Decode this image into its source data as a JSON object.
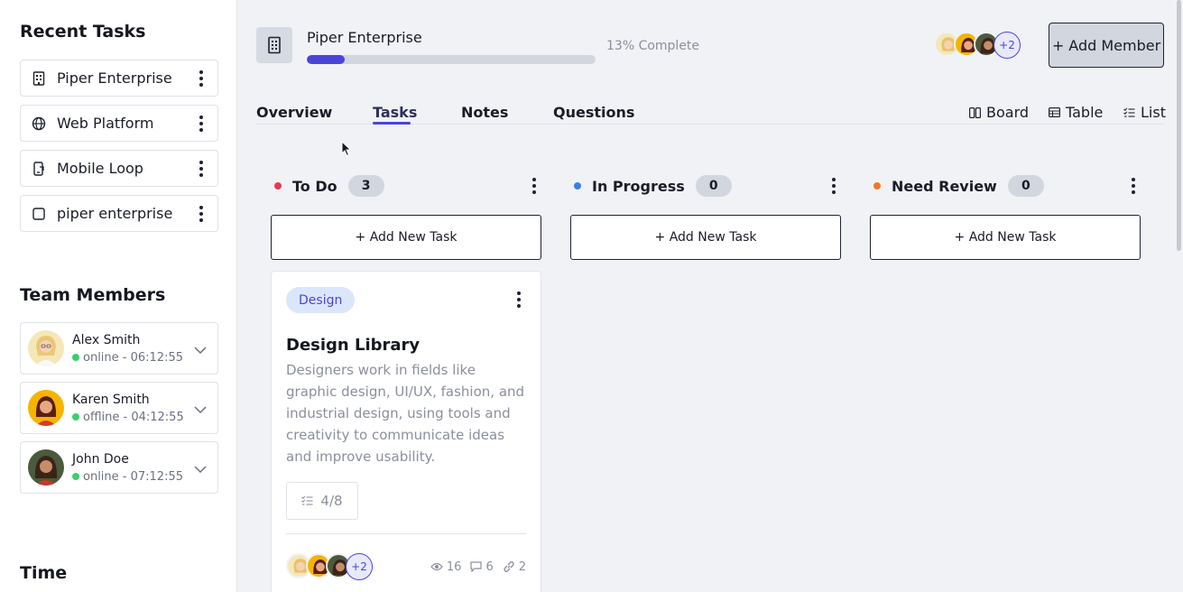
{
  "sidebar": {
    "recent_heading": "Recent Tasks",
    "recent": [
      {
        "label": "Piper Enterprise",
        "icon": "building-icon"
      },
      {
        "label": "Web Platform",
        "icon": "globe-icon"
      },
      {
        "label": "Mobile Loop",
        "icon": "mobile-icon"
      },
      {
        "label": "piper enterprise",
        "icon": "square-icon"
      }
    ],
    "team_heading": "Team Members",
    "members": [
      {
        "name": "Alex Smith",
        "status": "online - 06:12:55"
      },
      {
        "name": "Karen Smith",
        "status": "offline - 04:12:55"
      },
      {
        "name": "John Doe",
        "status": "online - 07:12:55"
      }
    ],
    "time_heading": "Time"
  },
  "header": {
    "project_title": "Piper Enterprise",
    "progress_percent": 13,
    "progress_text": "13% Complete",
    "members_more": "+2",
    "add_member_label": "+ Add Member"
  },
  "tabs": [
    {
      "label": "Overview"
    },
    {
      "label": "Tasks"
    },
    {
      "label": "Notes"
    },
    {
      "label": "Questions"
    }
  ],
  "views": [
    {
      "label": "Board"
    },
    {
      "label": "Table"
    },
    {
      "label": "List"
    }
  ],
  "columns": [
    {
      "title": "To Do",
      "count": "3",
      "color": "#e5395a",
      "add_label": "+ Add New Task"
    },
    {
      "title": "In Progress",
      "count": "0",
      "color": "#3b7ee8",
      "add_label": "+ Add New Task"
    },
    {
      "title": "Need Review",
      "count": "0",
      "color": "#f0782a",
      "add_label": "+ Add New Task"
    }
  ],
  "card": {
    "tag": "Design",
    "title": "Design Library",
    "description": "Designers work in fields like graphic design, UI/UX, fashion, and industrial design, using tools and creativity to communicate ideas and improve usability.",
    "checklist": "4/8",
    "assignees_more": "+2",
    "views": "16",
    "comments": "6",
    "links": "2"
  },
  "colors": {
    "accent": "#4a45d8",
    "online": "#3ccd6c"
  }
}
